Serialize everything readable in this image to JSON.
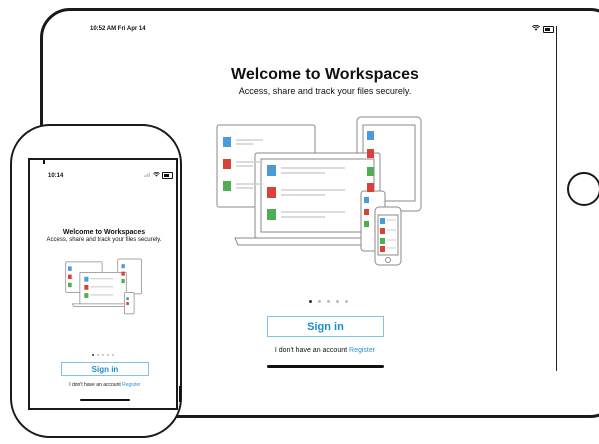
{
  "tablet": {
    "status_time": "10:52 AM  Fri Apr 14",
    "title": "Welcome to Workspaces",
    "subtitle": "Access, share and track your files securely.",
    "pager_pages": 5,
    "pager_active": 1,
    "signin_label": "Sign in",
    "no_account_text": "I don't have an account",
    "register_label": "Register"
  },
  "phone": {
    "status_time": "10:14",
    "title": "Welcome to Workspaces",
    "subtitle": "Access, share and track your files securely.",
    "pager_pages": 5,
    "pager_active": 1,
    "signin_label": "Sign in",
    "no_account_text": "I don't have an account",
    "register_label": "Register"
  },
  "icons": {
    "wifi": "wifi-icon",
    "battery": "battery-icon",
    "signal": "signal-icon",
    "document_blue": "document-icon",
    "pdf_red": "pdf-icon",
    "spreadsheet_green": "spreadsheet-icon"
  },
  "colors": {
    "accent": "#1a8fc9",
    "button_border": "#7fc4e3",
    "link": "#2f95d3",
    "doc_blue": "#4a9bd8",
    "pdf_red": "#d9423b",
    "sheet_green": "#4fae52",
    "illustration_stroke": "#8a8a8a"
  }
}
